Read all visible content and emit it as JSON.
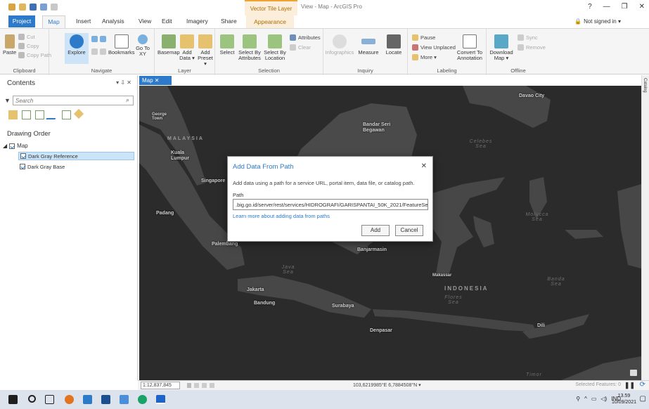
{
  "titlebar": {
    "context_tab": "Vector Tile Layer",
    "window_title": "View - Map - ArcGIS Pro",
    "help": "?",
    "minimize": "—",
    "restore": "❐",
    "close": "✕"
  },
  "ribbon_tabs": {
    "project": "Project",
    "map": "Map",
    "insert": "Insert",
    "analysis": "Analysis",
    "view": "View",
    "edit": "Edit",
    "imagery": "Imagery",
    "share": "Share",
    "appearance": "Appearance",
    "signin": "Not signed in ▾"
  },
  "ribbon": {
    "clipboard": {
      "label": "Clipboard",
      "paste": "Paste",
      "cut": "Cut",
      "copy": "Copy",
      "copy_path": "Copy Path"
    },
    "navigate": {
      "label": "Navigate",
      "explore": "Explore",
      "bookmarks": "Bookmarks",
      "goto": "Go To XY"
    },
    "layer": {
      "label": "Layer",
      "basemap": "Basemap",
      "add_data": "Add Data ▾",
      "add_preset": "Add Preset ▾"
    },
    "selection": {
      "label": "Selection",
      "select": "Select",
      "select_by_attributes": "Select By Attributes",
      "select_by_location": "Select By Location",
      "attributes": "Attributes",
      "clear": "Clear"
    },
    "inquiry": {
      "label": "Inquiry",
      "infographics": "Infographics",
      "measure": "Measure",
      "locate": "Locate"
    },
    "labeling": {
      "label": "Labeling",
      "pause": "Pause",
      "view_unplaced": "View Unplaced",
      "more": "More ▾",
      "convert": "Convert To Annotation"
    },
    "offline": {
      "label": "Offline",
      "download_map": "Download Map ▾",
      "sync": "Sync",
      "remove": "Remove"
    }
  },
  "contents": {
    "title": "Contents",
    "controls": "▾ ⇩ ✕",
    "search_placeholder": "Search",
    "drawing_order": "Drawing Order",
    "map_node": "Map",
    "layers": [
      "Dark Gray Reference",
      "Dark Gray Base"
    ]
  },
  "map_tab": "Map ✕",
  "catalog_tab": "Catalog",
  "map_labels": {
    "cities": [
      "Davao City",
      "George Town",
      "Bandar Seri Begawan",
      "Kuala Lumpur",
      "Singapore",
      "Padang",
      "Palembang",
      "Banjarmasin",
      "Makassar",
      "Jakarta",
      "Bandung",
      "Surabaya",
      "Denpasar",
      "Dili"
    ],
    "country": "INDONESIA",
    "malaysia": "MALAYSIA",
    "seas": [
      "Celebes Sea",
      "Java Sea",
      "Molucca Sea",
      "Banda Sea",
      "Flores Sea",
      "Timor"
    ]
  },
  "dialog": {
    "title": "Add Data From Path",
    "close": "✕",
    "description": "Add data using a path for a service URL, portal item, data file, or catalog path.",
    "path_label": "Path",
    "path_value": ".big.go.id/server/rest/services/HIDROGRAFI/GARISPANTAI_50K_2021/FeatureServer",
    "learn_link": "Learn more about adding data from paths",
    "add": "Add",
    "cancel": "Cancel"
  },
  "statusbar": {
    "scale": "1:12,837,845",
    "coords": "103,6219985°E 6,7884508°N",
    "selected_features": "Selected Features: 0"
  },
  "taskbar": {
    "clock_time": "13.59",
    "clock_date": "10/09/2021",
    "lang": "IND"
  }
}
